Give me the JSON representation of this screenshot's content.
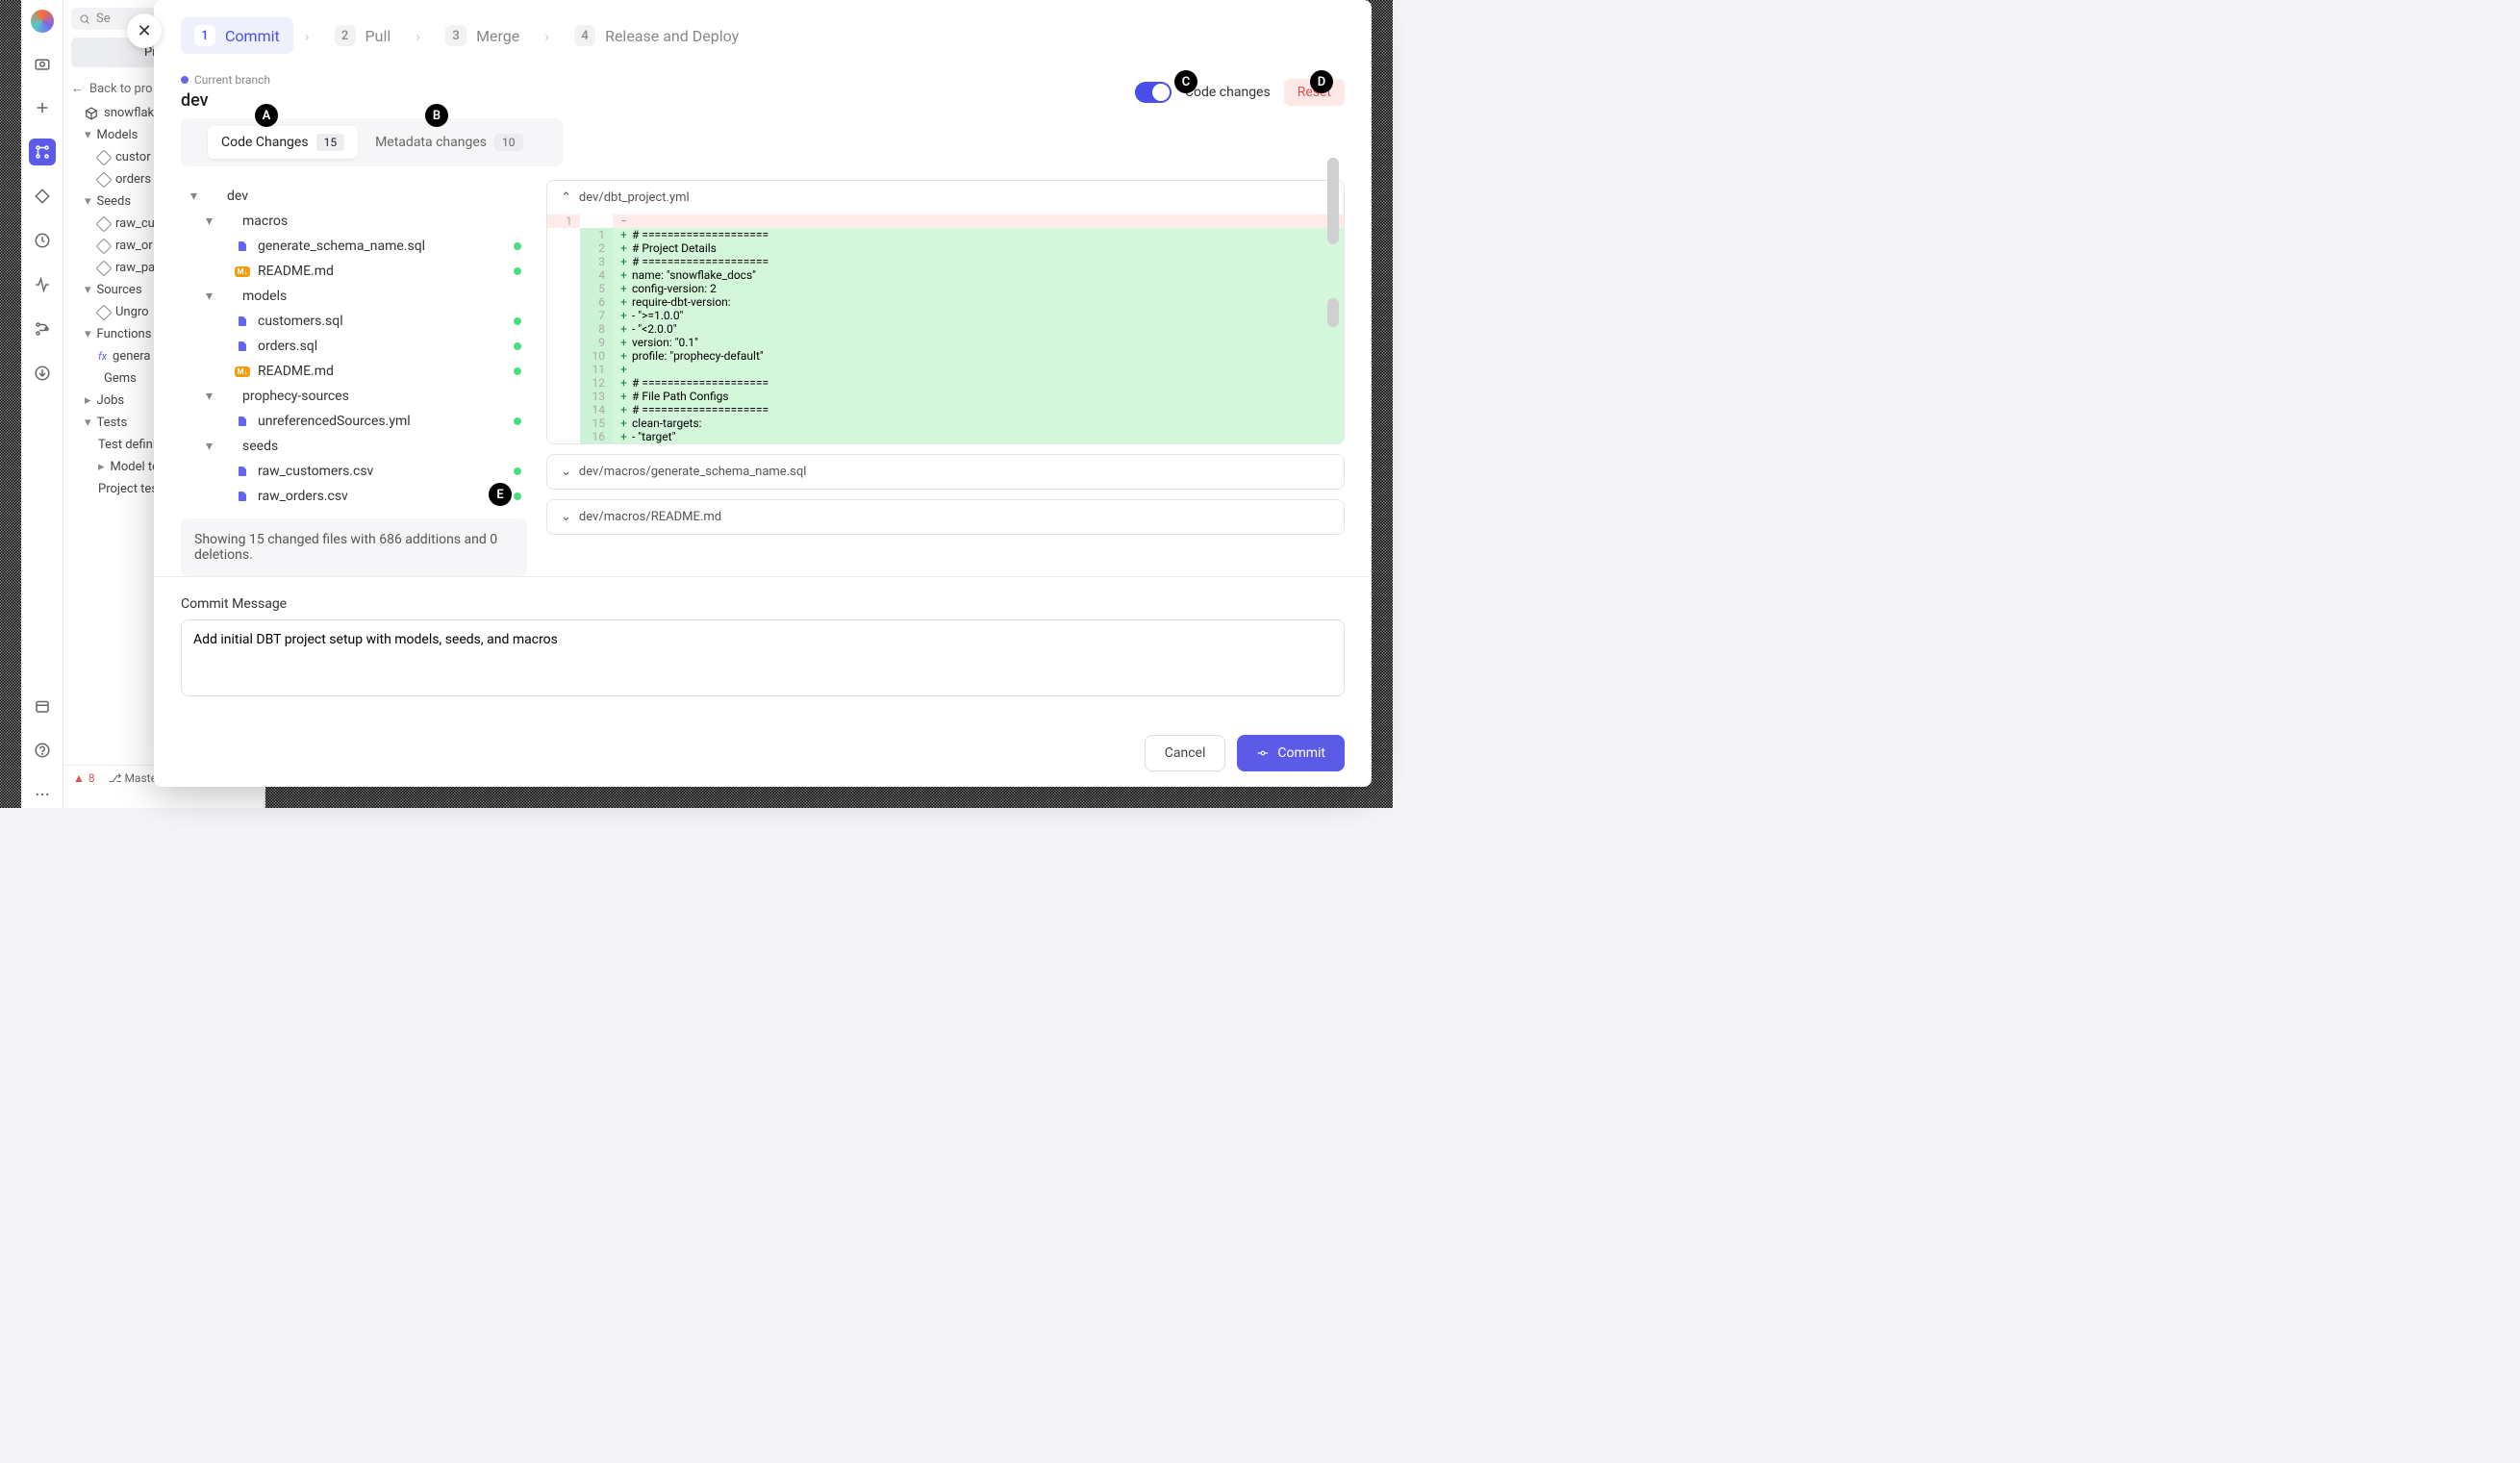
{
  "rail": {
    "active_index": 3
  },
  "tree_panel": {
    "search_placeholder": "Se",
    "project_btn": "Project",
    "back": "Back to pro",
    "connection": "snowflake",
    "groups": {
      "models": "Models",
      "models_items": [
        "custor",
        "orders"
      ],
      "seeds": "Seeds",
      "seeds_items": [
        "raw_cu",
        "raw_or",
        "raw_pa"
      ],
      "sources": "Sources",
      "sources_items": [
        "Ungro"
      ],
      "functions": "Functions",
      "functions_items": [
        "genera"
      ],
      "gems": "Gems",
      "jobs": "Jobs",
      "tests": "Tests",
      "tests_items": [
        "Test defini",
        "Model te",
        "Project tes"
      ]
    }
  },
  "status": {
    "errors": "8",
    "branch": "Master"
  },
  "steps": [
    {
      "num": "1",
      "label": "Commit",
      "active": true
    },
    {
      "num": "2",
      "label": "Pull"
    },
    {
      "num": "3",
      "label": "Merge"
    },
    {
      "num": "4",
      "label": "Release and Deploy"
    }
  ],
  "branch": {
    "label": "Current branch",
    "name": "dev"
  },
  "toggle_label": "Code changes",
  "reset": "Reset",
  "tabs": {
    "code": "Code Changes",
    "code_badge": "15",
    "meta": "Metadata changes",
    "meta_badge": "10"
  },
  "file_tree": [
    {
      "indent": 0,
      "caret": "▾",
      "name": "dev",
      "type": "folder"
    },
    {
      "indent": 1,
      "caret": "▾",
      "name": "macros",
      "type": "folder"
    },
    {
      "indent": 2,
      "name": "generate_schema_name.sql",
      "type": "file",
      "dot": true
    },
    {
      "indent": 2,
      "name": "README.md",
      "type": "md",
      "dot": true
    },
    {
      "indent": 1,
      "caret": "▾",
      "name": "models",
      "type": "folder"
    },
    {
      "indent": 2,
      "name": "customers.sql",
      "type": "file",
      "dot": true
    },
    {
      "indent": 2,
      "name": "orders.sql",
      "type": "file",
      "dot": true
    },
    {
      "indent": 2,
      "name": "README.md",
      "type": "md",
      "dot": true
    },
    {
      "indent": 1,
      "caret": "▾",
      "name": "prophecy-sources",
      "type": "folder"
    },
    {
      "indent": 2,
      "name": "unreferencedSources.yml",
      "type": "file",
      "dot": true
    },
    {
      "indent": 1,
      "caret": "▾",
      "name": "seeds",
      "type": "folder"
    },
    {
      "indent": 2,
      "name": "raw_customers.csv",
      "type": "file",
      "dot": true
    },
    {
      "indent": 2,
      "name": "raw_orders.csv",
      "type": "file",
      "dot": true
    }
  ],
  "summary": "Showing 15 changed files with 686 additions and 0 deletions.",
  "diff": {
    "path": "dev/dbt_project.yml",
    "old_line": "1",
    "lines": [
      {
        "n": "1",
        "t": "# ===================="
      },
      {
        "n": "2",
        "t": "# Project Details"
      },
      {
        "n": "3",
        "t": "# ===================="
      },
      {
        "n": "4",
        "t": "name: \"snowflake_docs\""
      },
      {
        "n": "5",
        "t": "config-version: 2"
      },
      {
        "n": "6",
        "t": "require-dbt-version:"
      },
      {
        "n": "7",
        "t": "- \">=1.0.0\""
      },
      {
        "n": "8",
        "t": "- \"<2.0.0\""
      },
      {
        "n": "9",
        "t": "version: \"0.1\""
      },
      {
        "n": "10",
        "t": "profile: \"prophecy-default\""
      },
      {
        "n": "11",
        "t": ""
      },
      {
        "n": "12",
        "t": "# ===================="
      },
      {
        "n": "13",
        "t": "# File Path Configs"
      },
      {
        "n": "14",
        "t": "# ===================="
      },
      {
        "n": "15",
        "t": "clean-targets:"
      },
      {
        "n": "16",
        "t": "- \"target\""
      }
    ],
    "collapsed": [
      "dev/macros/generate_schema_name.sql",
      "dev/macros/README.md"
    ]
  },
  "commit": {
    "label": "Commit Message",
    "value": "Add initial DBT project setup with models, seeds, and macros"
  },
  "footer": {
    "cancel": "Cancel",
    "commit": "Commit"
  },
  "annotations": [
    "A",
    "B",
    "C",
    "D",
    "E"
  ]
}
